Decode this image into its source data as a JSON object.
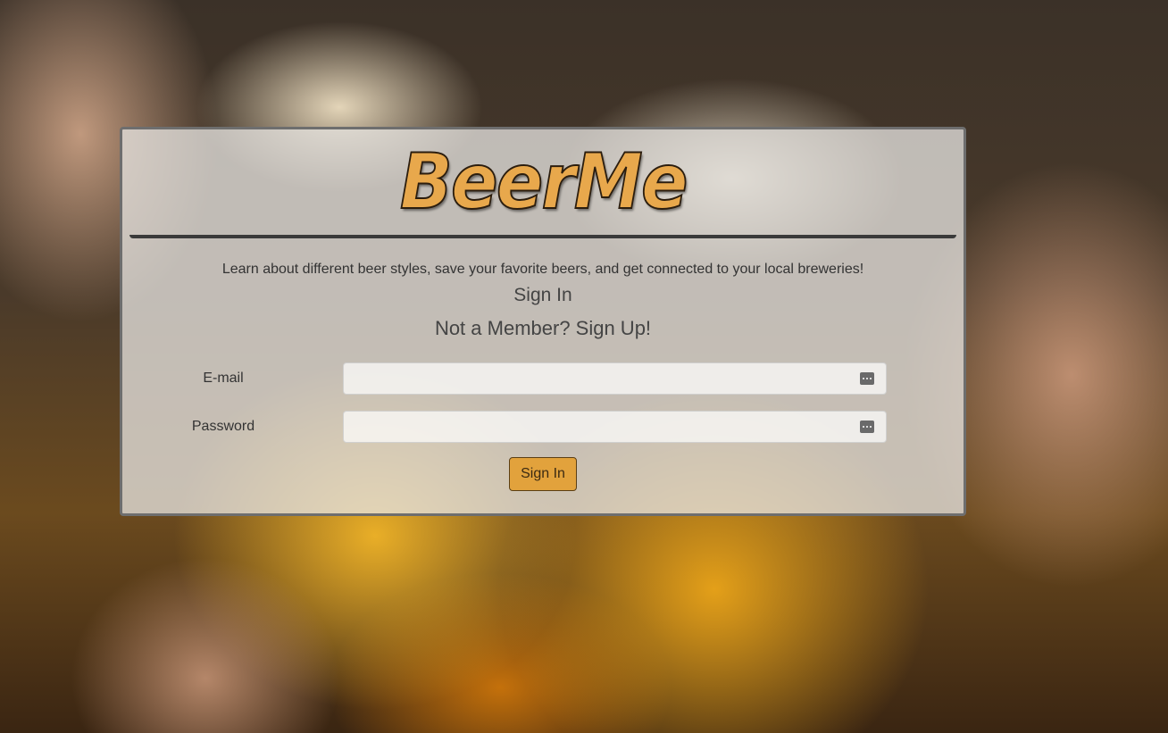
{
  "brand": {
    "logo_text": "BeerMe",
    "accent_color": "#e2a23c"
  },
  "intro": {
    "tagline": "Learn about different beer styles, save your favorite beers, and get connected to your local breweries!",
    "sign_in_heading": "Sign In",
    "signup_link": "Not a Member? Sign Up!"
  },
  "form": {
    "email": {
      "label": "E-mail",
      "value": "",
      "placeholder": "",
      "icon": "password-manager-icon"
    },
    "password": {
      "label": "Password",
      "value": "",
      "placeholder": "",
      "icon": "password-manager-icon"
    },
    "submit_label": "Sign In"
  }
}
